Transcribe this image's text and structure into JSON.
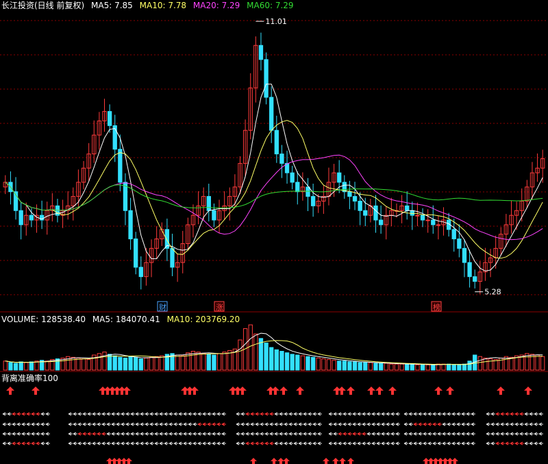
{
  "colors": {
    "up": "#ff3b3b",
    "down": "#33e0ff",
    "ma5": "#ffffff",
    "ma10": "#ffff66",
    "ma20": "#ff44ff",
    "ma60": "#33dd33",
    "grid": "#8b0000",
    "text": "#ffffff",
    "accent_red": "#ff3333"
  },
  "price_panel": {
    "title": "长江投资(日线 前复权)",
    "ma5_label": "MA5: 7.85",
    "ma10_label": "MA10: 7.78",
    "ma20_label": "MA20: 7.29",
    "ma60_label": "MA60: 7.29",
    "high_label": "11.01",
    "low_label": "5.28",
    "markers": [
      "财",
      "涨",
      "榜"
    ]
  },
  "volume_panel": {
    "volume_label": "VOLUME: 128538.40",
    "ma5_label": "MA5: 184070.41",
    "ma10_label": "MA10: 203769.20"
  },
  "indicator_panel": {
    "title": "背离准确率100"
  },
  "chart_data": {
    "type": "candlestick",
    "title": "长江投资(日线 前复权)",
    "price_range": [
      5.28,
      11.01
    ],
    "series": [
      {
        "name": "MA5",
        "last": 7.85
      },
      {
        "name": "MA10",
        "last": 7.78
      },
      {
        "name": "MA20",
        "last": 7.29
      },
      {
        "name": "MA60",
        "last": 7.29
      }
    ],
    "volume": {
      "last": 128538.4,
      "ma5": 184070.41,
      "ma10": 203769.2
    },
    "close": [
      7.6,
      7.4,
      7.0,
      6.7,
      6.9,
      6.8,
      6.9,
      6.8,
      7.0,
      7.1,
      6.9,
      7.0,
      7.1,
      7.3,
      7.6,
      7.9,
      8.2,
      8.6,
      8.9,
      9.1,
      8.8,
      8.3,
      7.6,
      7.0,
      6.4,
      5.8,
      5.6,
      5.9,
      6.2,
      6.4,
      6.6,
      6.2,
      5.8,
      5.9,
      6.3,
      6.7,
      6.9,
      7.1,
      7.3,
      7.0,
      6.8,
      7.0,
      7.1,
      7.3,
      7.5,
      8.0,
      8.7,
      9.6,
      10.5,
      10.2,
      9.4,
      8.7,
      8.2,
      8.0,
      7.8,
      7.6,
      7.4,
      7.5,
      7.3,
      7.1,
      7.2,
      7.3,
      7.6,
      7.8,
      7.6,
      7.4,
      7.3,
      7.2,
      7.0,
      6.9,
      7.1,
      6.8,
      6.7,
      6.9,
      7.0,
      7.0,
      7.1,
      7.0,
      6.9,
      6.9,
      6.8,
      6.8,
      6.7,
      6.7,
      6.8,
      6.6,
      6.4,
      6.2,
      5.9,
      5.6,
      5.5,
      5.7,
      5.9,
      6.0,
      6.2,
      6.5,
      6.7,
      6.9,
      7.0,
      7.2,
      7.5,
      7.8,
      7.9,
      8.1
    ],
    "volume_values": [
      12,
      10,
      9,
      11,
      10,
      11,
      12,
      13,
      12,
      14,
      15,
      16,
      18,
      17,
      16,
      15,
      14,
      20,
      22,
      24,
      21,
      19,
      17,
      16,
      18,
      17,
      15,
      16,
      17,
      18,
      19,
      21,
      22,
      20,
      19,
      23,
      25,
      24,
      22,
      21,
      20,
      22,
      24,
      26,
      28,
      40,
      55,
      60,
      48,
      42,
      36,
      30,
      27,
      25,
      23,
      21,
      20,
      19,
      18,
      17,
      16,
      15,
      14,
      13,
      12,
      12,
      11,
      11,
      10,
      10,
      10,
      9,
      9,
      9,
      8,
      8,
      8,
      8,
      8,
      7,
      7,
      7,
      7,
      8,
      8,
      8,
      7,
      7,
      8,
      12,
      20,
      18,
      16,
      15,
      14,
      16,
      18,
      17,
      19,
      20,
      22,
      21,
      20,
      18
    ]
  }
}
